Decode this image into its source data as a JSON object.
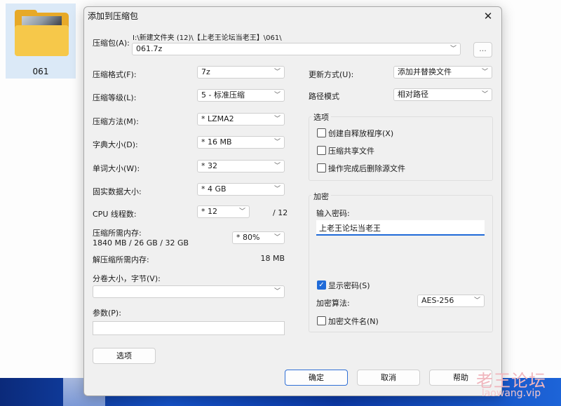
{
  "desktop": {
    "folder_label": "061"
  },
  "dialog": {
    "title": "添加到压缩包",
    "archive_label": "压缩包(A):",
    "archive_path": "I:\\新建文件夹 (12)\\【上老王论坛当老王】\\061\\",
    "archive_name": "061.7z",
    "browse_label": "...",
    "left": {
      "format_label": "压缩格式(F):",
      "format_value": "7z",
      "level_label": "压缩等级(L):",
      "level_value": "5 - 标准压缩",
      "method_label": "压缩方法(M):",
      "method_value": "*  LZMA2",
      "dict_label": "字典大小(D):",
      "dict_value": "*  16 MB",
      "word_label": "单词大小(W):",
      "word_value": "*  32",
      "solid_label": "固实数据大小:",
      "solid_value": "*  4 GB",
      "threads_label": "CPU 线程数:",
      "threads_value": "*  12",
      "threads_total": "/ 12",
      "mem_label": "压缩所需内存:",
      "mem_detail": "1840 MB / 26 GB / 32 GB",
      "mem_value": "*  80%",
      "decomp_label": "解压缩所需内存:",
      "decomp_value": "18 MB",
      "volume_label": "分卷大小，字节(V):",
      "volume_value": "",
      "params_label": "参数(P):",
      "params_value": "",
      "options_button": "选项"
    },
    "right": {
      "update_label": "更新方式(U):",
      "update_value": "添加并替换文件",
      "pathmode_label": "路径模式",
      "pathmode_value": "相对路径",
      "options_group": "选项",
      "opt_sfx": "创建自释放程序(X)",
      "opt_shared": "压缩共享文件",
      "opt_delete": "操作完成后删除源文件",
      "encrypt_group": "加密",
      "password_label": "输入密码:",
      "password_value": "上老王论坛当老王",
      "show_password": "显示密码(S)",
      "show_password_checked": true,
      "algo_label": "加密算法:",
      "algo_value": "AES-256",
      "encrypt_names": "加密文件名(N)"
    },
    "buttons": {
      "ok": "确定",
      "cancel": "取消",
      "help": "帮助"
    }
  },
  "watermark": {
    "cn": "老王论坛",
    "en": "laowang.vip"
  },
  "colors": {
    "accent": "#1f6ad8",
    "dialog_bg": "#f0f0f0",
    "folder": "#f6c84a"
  }
}
